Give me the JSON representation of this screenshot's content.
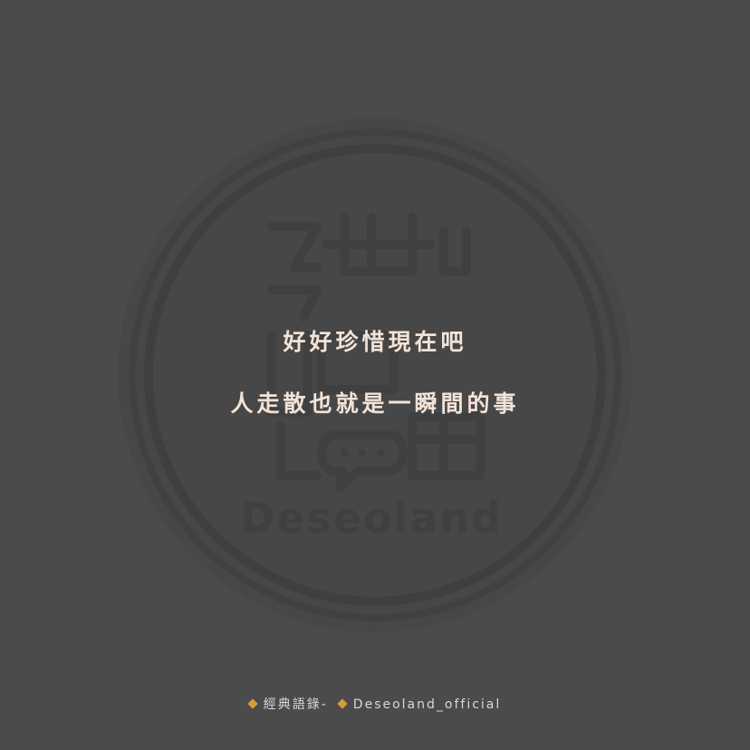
{
  "logo": {
    "wordmark": "Deseoland",
    "icon_name": "deseoland-logo-watermark"
  },
  "quote": {
    "line1": "好好珍惜現在吧",
    "line2": "人走散也就是一瞬間的事"
  },
  "footer": {
    "left_icon": "diamond-bullet-icon",
    "left_text": "經典語錄-",
    "right_icon": "diamond-bullet-icon",
    "right_text": "Deseoland_official"
  },
  "colors": {
    "background": "#4b4b4b",
    "quote_text": "#f3e3d7",
    "bullet": "#d99a3a",
    "footer_text": "#d7d7d7"
  }
}
